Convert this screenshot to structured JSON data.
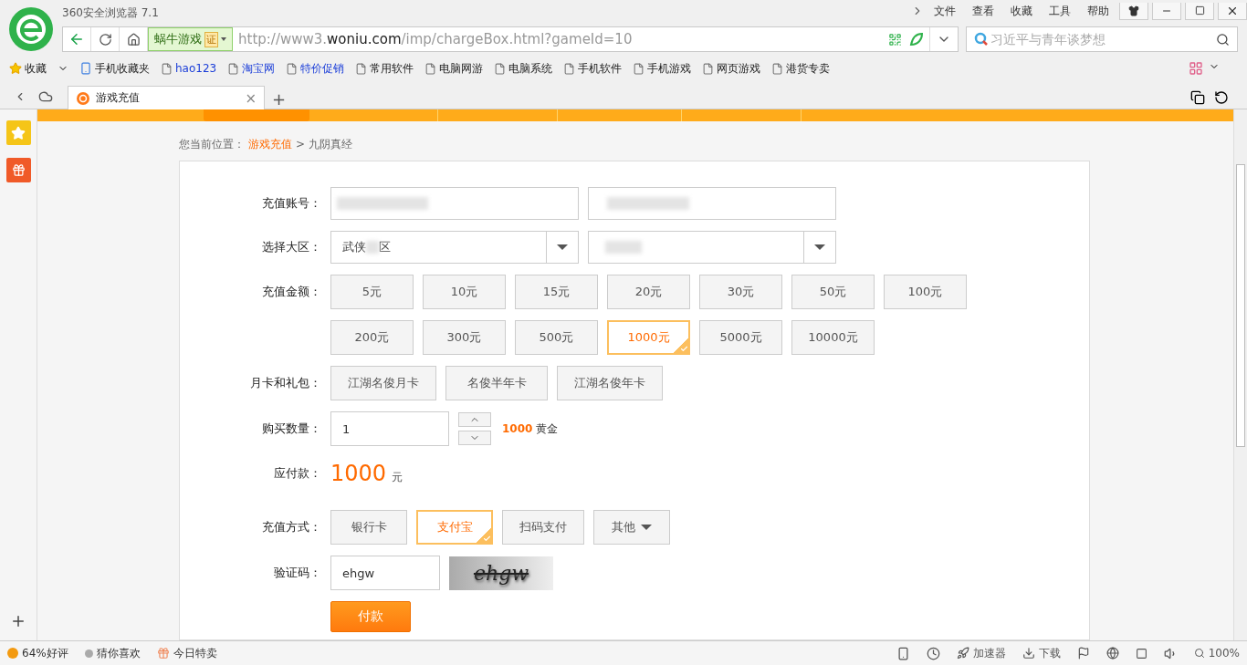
{
  "browser": {
    "title": "360安全浏览器 7.1",
    "menu": [
      "文件",
      "查看",
      "收藏",
      "工具",
      "帮助"
    ],
    "address": {
      "site_badge": "蜗牛游戏",
      "cert": "证",
      "url_prefix": "http://www3.",
      "url_domain": "woniu.com",
      "url_path": "/imp/chargeBox.html?gameId=10"
    },
    "search": {
      "placeholder": "习近平与青年谈梦想"
    },
    "bookmarks": [
      {
        "label": "收藏",
        "kind": "favorites",
        "highlighted": false
      },
      {
        "label": "手机收藏夹",
        "kind": "phone",
        "highlighted": false
      },
      {
        "label": "hao123",
        "kind": "page",
        "highlighted": true
      },
      {
        "label": "淘宝网",
        "kind": "page",
        "highlighted": true
      },
      {
        "label": "特价促销",
        "kind": "page",
        "highlighted": true
      },
      {
        "label": "常用软件",
        "kind": "page",
        "highlighted": false
      },
      {
        "label": "电脑网游",
        "kind": "page",
        "highlighted": false
      },
      {
        "label": "电脑系统",
        "kind": "page",
        "highlighted": false
      },
      {
        "label": "手机软件",
        "kind": "page",
        "highlighted": false
      },
      {
        "label": "手机游戏",
        "kind": "page",
        "highlighted": false
      },
      {
        "label": "网页游戏",
        "kind": "page",
        "highlighted": false
      },
      {
        "label": "港货专卖",
        "kind": "page",
        "highlighted": false
      }
    ],
    "tab": {
      "title": "游戏充值",
      "close": "×",
      "new_tab": "+"
    }
  },
  "page": {
    "breadcrumb": {
      "prefix": "您当前位置：",
      "link": "游戏充值",
      "separator": ">",
      "current": "九阴真经"
    },
    "form": {
      "account_label": "充值账号：",
      "region_label": "选择大区：",
      "region_start": "武侠",
      "region_end": "区",
      "amount_label": "充值金额：",
      "amounts": [
        {
          "label": "5元",
          "selected": false
        },
        {
          "label": "10元",
          "selected": false
        },
        {
          "label": "15元",
          "selected": false
        },
        {
          "label": "20元",
          "selected": false
        },
        {
          "label": "30元",
          "selected": false
        },
        {
          "label": "50元",
          "selected": false
        },
        {
          "label": "100元",
          "selected": false
        },
        {
          "label": "200元",
          "selected": false
        },
        {
          "label": "300元",
          "selected": false
        },
        {
          "label": "500元",
          "selected": false
        },
        {
          "label": "1000元",
          "selected": true
        },
        {
          "label": "5000元",
          "selected": false
        },
        {
          "label": "10000元",
          "selected": false
        }
      ],
      "pack_label": "月卡和礼包：",
      "packs": [
        {
          "label": "江湖名俊月卡",
          "selected": false
        },
        {
          "label": "名俊半年卡",
          "selected": false
        },
        {
          "label": "江湖名俊年卡",
          "selected": false
        }
      ],
      "quantity_label": "购买数量：",
      "quantity": "1",
      "gold_amount": "1000",
      "gold_unit": "黄金",
      "total_label": "应付款：",
      "total": "1000",
      "total_unit": "元",
      "method_label": "充值方式：",
      "methods": [
        {
          "label": "银行卡",
          "selected": false,
          "kind": "plain"
        },
        {
          "label": "支付宝",
          "selected": true,
          "kind": "plain"
        },
        {
          "label": "扫码支付",
          "selected": false,
          "kind": "plain"
        },
        {
          "label": "其他",
          "selected": false,
          "kind": "dropdown"
        }
      ],
      "captcha_label": "验证码：",
      "captcha_value": "ehgw",
      "captcha_image": "ehgw",
      "submit": "付款"
    }
  },
  "status_bar": {
    "left": [
      {
        "label": "64%好评",
        "kind": "rating"
      },
      {
        "label": "猜你喜欢",
        "kind": "dot"
      },
      {
        "label": "今日特卖",
        "kind": "gift"
      }
    ],
    "right": [
      {
        "label": "加速器",
        "kind": "rocket"
      },
      {
        "label": "下载",
        "kind": "download"
      }
    ],
    "zoom": "100%"
  }
}
